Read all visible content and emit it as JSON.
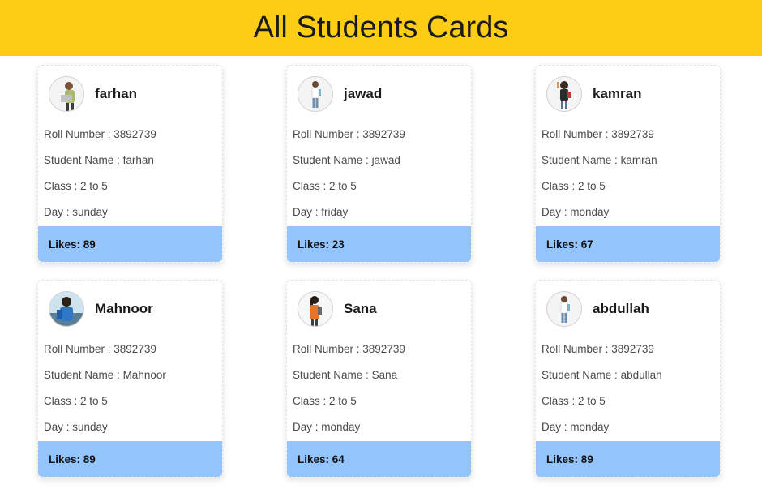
{
  "header": {
    "title": "All Students Cards"
  },
  "labels": {
    "roll": "Roll Number : ",
    "student_name": "Student Name : ",
    "class": "Class : ",
    "day": "Day : ",
    "likes": "Likes: "
  },
  "students": [
    {
      "name": "farhan",
      "roll": "3892739",
      "class": "2 to 5",
      "day": "sunday",
      "likes": "89",
      "avatar": "student-with-laptop-photo"
    },
    {
      "name": "jawad",
      "roll": "3892739",
      "class": "2 to 5",
      "day": "friday",
      "likes": "23",
      "avatar": "student-standing-photo"
    },
    {
      "name": "kamran",
      "roll": "3892739",
      "class": "2 to 5",
      "day": "monday",
      "likes": "67",
      "avatar": "student-thumbs-up-photo"
    },
    {
      "name": "Mahnoor",
      "roll": "3892739",
      "class": "2 to 5",
      "day": "sunday",
      "likes": "89",
      "avatar": "student-girl-blue-photo"
    },
    {
      "name": "Sana",
      "roll": "3892739",
      "class": "2 to 5",
      "day": "monday",
      "likes": "64",
      "avatar": "student-girl-orange-photo"
    },
    {
      "name": "abdullah",
      "roll": "3892739",
      "class": "2 to 5",
      "day": "monday",
      "likes": "89",
      "avatar": "student-standing-photo"
    }
  ],
  "colors": {
    "header_bg": "#fbcd15",
    "likes_bg": "#93c5fc",
    "card_bg": "#ffffff"
  }
}
